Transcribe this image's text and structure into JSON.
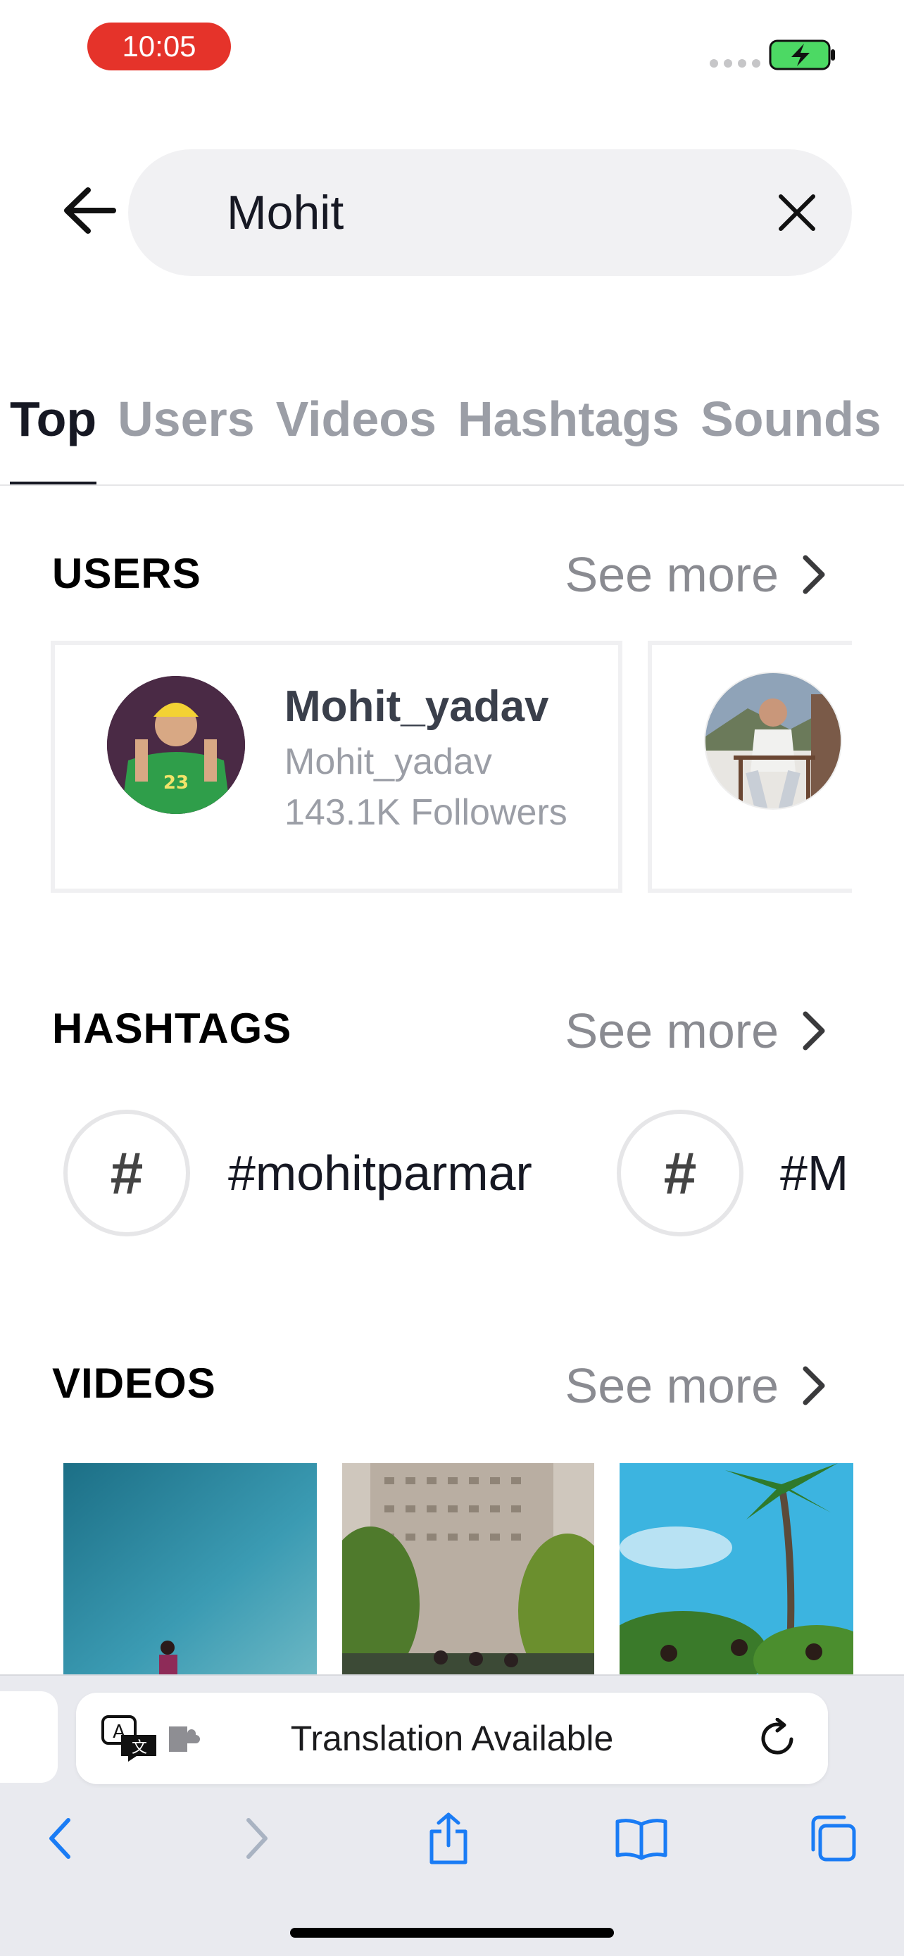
{
  "status_bar": {
    "time": "10:05"
  },
  "search": {
    "value": "Mohit"
  },
  "tabs": [
    {
      "label": "Top",
      "active": true
    },
    {
      "label": "Users",
      "active": false
    },
    {
      "label": "Videos",
      "active": false
    },
    {
      "label": "Hashtags",
      "active": false
    },
    {
      "label": "Sounds",
      "active": false
    }
  ],
  "users_section": {
    "title": "USERS",
    "see_more": "See more",
    "users": [
      {
        "name": "Mohit_yadav",
        "handle": "Mohit_yadav",
        "followers": "143.1K Followers"
      }
    ]
  },
  "hashtags_section": {
    "title": "HASHTAGS",
    "see_more": "See more",
    "hashtags": [
      "#mohitparmar",
      "#M"
    ]
  },
  "videos_section": {
    "title": "VIDEOS",
    "see_more": "See more"
  },
  "browser": {
    "translation_text": "Translation Available"
  },
  "icons": {
    "back": "back-arrow-icon",
    "clear": "close-icon",
    "chevron": "chevron-right-icon",
    "hashtag": "hashtag-icon",
    "translate": "translate-icon",
    "extension": "puzzle-icon",
    "reload": "reload-icon",
    "nav_back": "chevron-left-icon",
    "nav_forward": "chevron-right-icon",
    "share": "share-icon",
    "bookmarks": "book-icon",
    "tabs": "tabs-icon"
  },
  "colors": {
    "time_pill": "#e5332a",
    "battery": "#4cd964",
    "accent_blue": "#1a7cf5",
    "active_tab": "#161823",
    "inactive_tab": "#9b9ea6"
  }
}
